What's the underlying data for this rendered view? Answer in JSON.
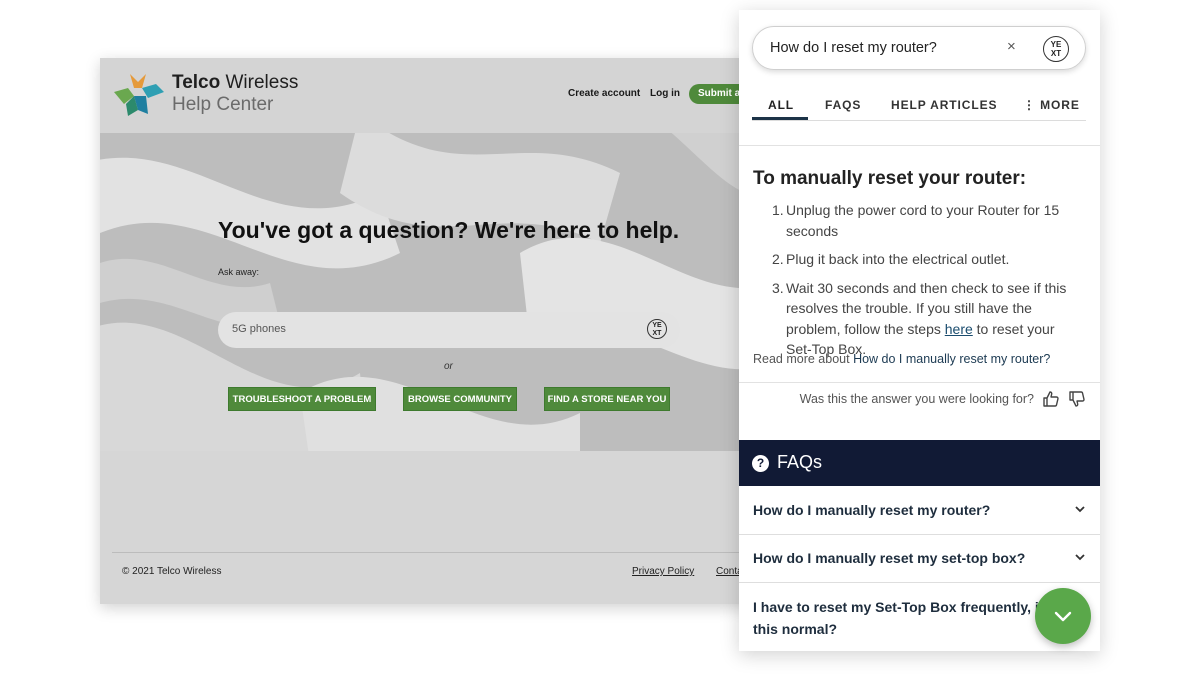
{
  "site": {
    "brand_line1_bold": "Telco",
    "brand_line1_rest": " Wireless",
    "brand_line2": "Help Center",
    "nav": {
      "create_account": "Create account",
      "log_in": "Log in",
      "submit": "Submit a"
    },
    "hero": {
      "title": "You've got a question? We're here to help.",
      "ask_label": "Ask away:",
      "search_value": "5G phones",
      "or": "or",
      "cta": [
        "TROUBLESHOOT A PROBLEM",
        "BROWSE COMMUNITY",
        "FIND A STORE NEAR YOU"
      ]
    },
    "footer": {
      "copyright": "© 2021 Telco Wireless",
      "privacy": "Privacy Policy",
      "contact": "Conta"
    }
  },
  "panel": {
    "query": "How do I reset my router?",
    "clear": "×",
    "search_icon_glyph": "YES\nX T",
    "tabs": [
      "ALL",
      "FAQS",
      "HELP ARTICLES",
      "⋮ MORE"
    ],
    "answer": {
      "title": "To manually reset your router:",
      "steps": [
        {
          "n": "1.",
          "text": "Unplug the power cord to your Router for 15 seconds"
        },
        {
          "n": "2.",
          "text": "Plug it back into the electrical outlet."
        },
        {
          "n": "3.",
          "text_before": "Wait 30 seconds and then check to see if this resolves the trouble. If you still have the problem, follow the steps ",
          "link": "here",
          "text_after": " to reset your Set-Top Box."
        }
      ],
      "read_more_prefix": "Read more about ",
      "read_more_link": "How do I manually reset my router?",
      "feedback": "Was this the answer you were looking for?"
    },
    "faqs": {
      "icon": "?",
      "title": "FAQs",
      "items": [
        "How do I manually reset my router?",
        "How do I manually reset my set-top box?",
        "I have to reset my Set-Top Box frequently, is this normal?"
      ]
    }
  },
  "colors": {
    "brand_green": "#4f8a3b",
    "faq_navy": "#111a35",
    "fab_green": "#5aa84a"
  }
}
